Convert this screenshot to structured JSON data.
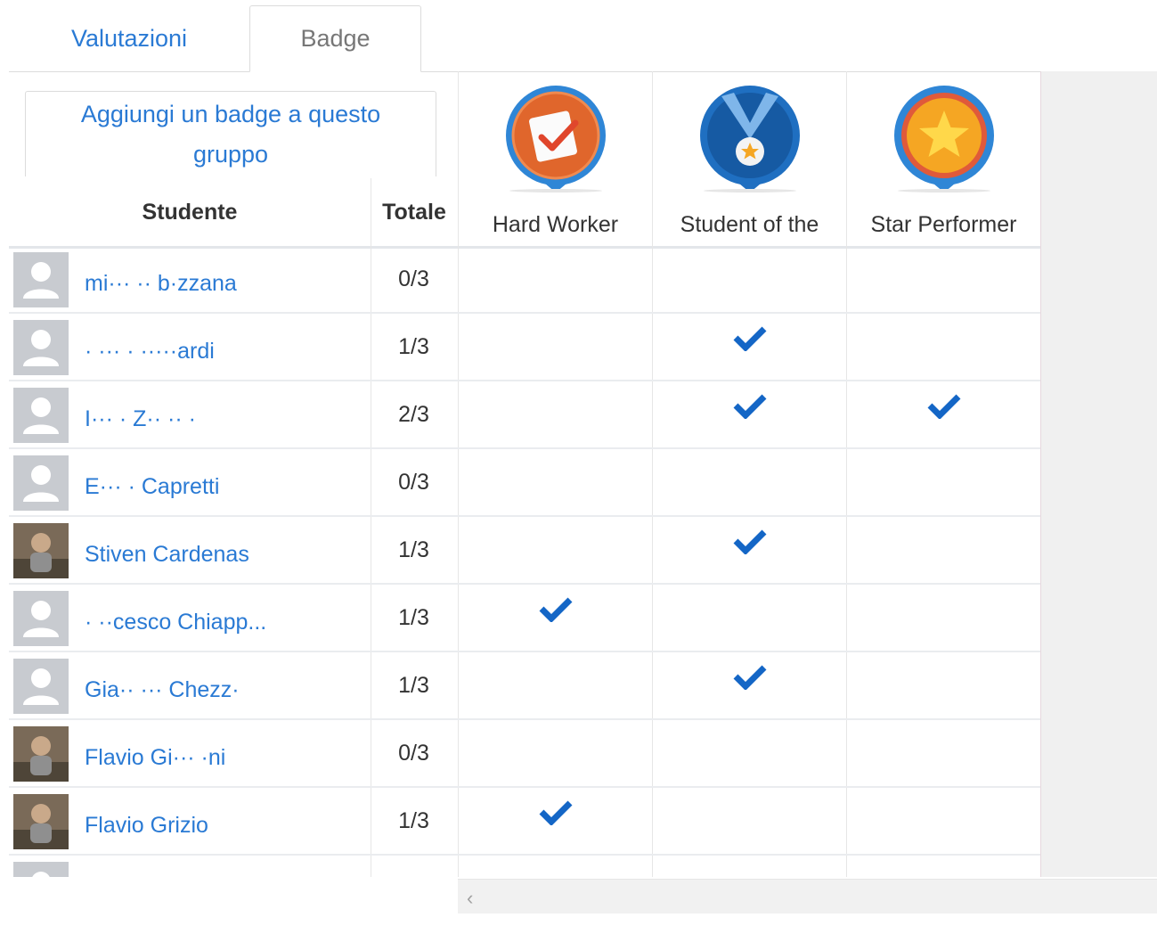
{
  "tabs": [
    {
      "label": "Valutazioni",
      "active": false
    },
    {
      "label": "Badge",
      "active": true
    }
  ],
  "add_badge_button": "Aggiungi un badge a questo gruppo",
  "table": {
    "headers": {
      "student": "Studente",
      "total": "Totale"
    },
    "badges": [
      {
        "name": "Hard Worker",
        "icon": "hard-worker-badge-icon",
        "color": "#e0662c"
      },
      {
        "name": "Student of the",
        "icon": "student-of-the-month-badge-icon",
        "color": "#1f6fc1"
      },
      {
        "name": "Star Performer",
        "icon": "star-performer-badge-icon",
        "color": "#f5a623"
      }
    ],
    "rows": [
      {
        "name": "mi··· ·· b·zzana",
        "total": "0/3",
        "avatar": "default",
        "badges": [
          false,
          false,
          false
        ]
      },
      {
        "name": "· ··· · ·····ardi",
        "total": "1/3",
        "avatar": "default",
        "badges": [
          false,
          true,
          false
        ]
      },
      {
        "name": "I··· · Z·· ·· ·",
        "total": "2/3",
        "avatar": "default",
        "badges": [
          false,
          true,
          true
        ]
      },
      {
        "name": "E··· · Capretti",
        "total": "0/3",
        "avatar": "default",
        "badges": [
          false,
          false,
          false
        ]
      },
      {
        "name": "Stiven Cardenas",
        "total": "1/3",
        "avatar": "photo",
        "badges": [
          false,
          true,
          false
        ]
      },
      {
        "name": "· ··cesco Chiapp...",
        "total": "1/3",
        "avatar": "default",
        "badges": [
          true,
          false,
          false
        ]
      },
      {
        "name": "Gia·· ··· Chezz·",
        "total": "1/3",
        "avatar": "default",
        "badges": [
          false,
          true,
          false
        ]
      },
      {
        "name": "Flavio Gi··· ·ni",
        "total": "0/3",
        "avatar": "photo",
        "badges": [
          false,
          false,
          false
        ]
      },
      {
        "name": "Flavio Grizio",
        "total": "1/3",
        "avatar": "photo",
        "badges": [
          true,
          false,
          false
        ]
      },
      {
        "name": "",
        "total": "",
        "avatar": "default",
        "badges": [
          false,
          false,
          false
        ]
      }
    ]
  },
  "scrollbar": {
    "left_arrow": "‹"
  },
  "colors": {
    "link": "#2a7ad4",
    "check": "#1466c6"
  }
}
